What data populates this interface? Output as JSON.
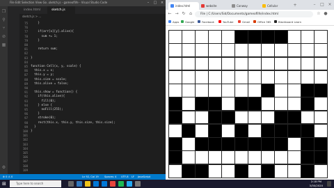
{
  "vscode": {
    "window_title": "sketch.js - gameoflife - Visual Studio Code",
    "menu": "File Edit Selection View Go ...",
    "tabs": [
      {
        "label": "index.html"
      },
      {
        "label": "sketch.js"
      }
    ],
    "breadcrumb": "sketch.js > ...",
    "line_numbers": [
      "75",
      "76",
      "77",
      "78",
      "79",
      "80",
      "81",
      "82",
      "83",
      "84",
      "85",
      "86",
      "87",
      "88",
      "89",
      "90",
      "91",
      "92",
      "93",
      "94",
      "95",
      "96",
      "97",
      "98",
      "99",
      "100",
      "101",
      "102",
      "103",
      "104",
      "105",
      "106",
      "107",
      "108",
      "109"
    ],
    "code_lines": [
      "    }",
      "",
      "    if(arr[x][y].alive){",
      "      sum += 1;",
      "    }",
      "",
      "    return sum;",
      "",
      "}",
      "",
      "function Cell(x, y, scale) {",
      "  this.x = x;",
      "  this.y = y;",
      "  this.size = scale;",
      "  this.alive = false;",
      "",
      "  this.show = function() {",
      "    if(this.alive){",
      "      fill(0);",
      "    } else {",
      "      noFill(255);",
      "    }",
      "    stroke(0);",
      "    rect(this.x, this.y, this.size, this.size);",
      "  }",
      "}",
      ""
    ],
    "status": {
      "left": "⊗ 0 ⚠ 0",
      "position": "Ln 92, Col 19",
      "spaces": "Spaces: 4",
      "encoding": "UTF-8",
      "eol": "LF",
      "language": "JavaScript"
    }
  },
  "browser": {
    "tabs": [
      {
        "label": "index.html"
      },
      {
        "label": "website"
      },
      {
        "label": "Conway"
      },
      {
        "label": "Cellular"
      }
    ],
    "url": "File | C:/Users/Sid/Documents/gameoflife/index.html",
    "bookmarks": [
      "Apps",
      "Google",
      "Facebook",
      "YouTube",
      "Gmail",
      "Office 365",
      "Blackboard Learn"
    ],
    "grid": {
      "rows": 11,
      "cols": 12,
      "alive": [
        [
          0,
          0,
          0,
          0,
          0,
          1,
          1,
          1,
          1,
          0,
          0,
          0
        ],
        [
          0,
          0,
          0,
          0,
          0,
          0,
          0,
          0,
          0,
          0,
          0,
          0
        ],
        [
          0,
          0,
          0,
          0,
          0,
          0,
          0,
          0,
          0,
          0,
          0,
          0
        ],
        [
          0,
          0,
          0,
          0,
          0,
          0,
          0,
          0,
          0,
          0,
          0,
          0
        ],
        [
          0,
          0,
          0,
          0,
          0,
          0,
          0,
          1,
          0,
          0,
          1,
          1
        ],
        [
          1,
          0,
          1,
          1,
          0,
          1,
          1,
          0,
          0,
          0,
          1,
          0
        ],
        [
          1,
          0,
          0,
          1,
          1,
          0,
          0,
          0,
          1,
          1,
          0,
          0
        ],
        [
          0,
          1,
          0,
          1,
          0,
          1,
          0,
          1,
          1,
          1,
          1,
          0
        ],
        [
          1,
          0,
          1,
          1,
          1,
          1,
          1,
          1,
          1,
          0,
          1,
          1
        ],
        [
          1,
          0,
          0,
          0,
          0,
          0,
          0,
          0,
          0,
          0,
          1,
          1
        ],
        [
          0,
          1,
          1,
          0,
          0,
          1,
          0,
          1,
          0,
          0,
          1,
          0
        ]
      ]
    }
  },
  "taskbar": {
    "search_placeholder": "Type here to search",
    "time": "2:18 PM",
    "date": "3/30/2020"
  },
  "colors": {
    "vscode_status": "#007acc",
    "keyword": "#569cd6",
    "function": "#dcdcaa"
  }
}
